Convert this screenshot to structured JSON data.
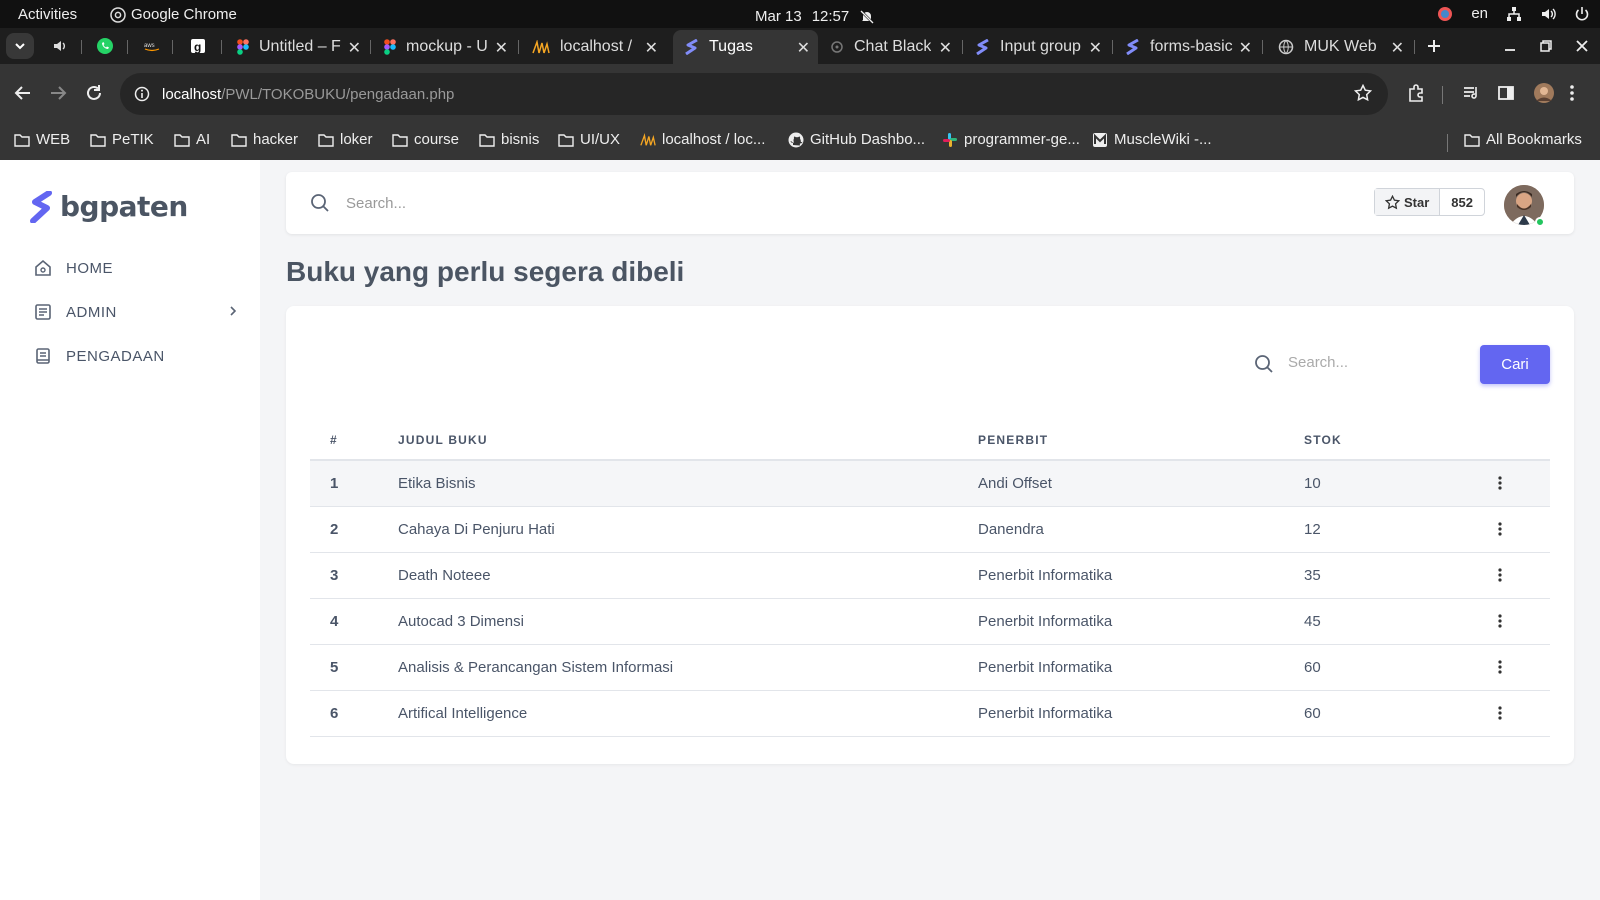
{
  "os_bar": {
    "activities": "Activities",
    "app_name": "Google Chrome",
    "date": "Mar 13",
    "time": "12:57",
    "language": "en"
  },
  "tabs": [
    {
      "title": "Untitled – F",
      "icon": "figma-icon"
    },
    {
      "title": "mockup - U",
      "icon": "figma-icon"
    },
    {
      "title": "localhost / ",
      "icon": "phpmyadmin-icon"
    },
    {
      "title": "Tugas",
      "icon": "bgpaten-icon",
      "active": true
    },
    {
      "title": "Chat Black",
      "icon": "blackbox-icon"
    },
    {
      "title": "Input group",
      "icon": "bgpaten-icon"
    },
    {
      "title": "forms-basic",
      "icon": "bgpaten-icon"
    },
    {
      "title": "MUK Web",
      "icon": "globe-icon"
    }
  ],
  "address_bar": {
    "host": "localhost",
    "path": "/PWL/TOKOBUKU/pengadaan.php"
  },
  "bookmarks": [
    {
      "label": "WEB",
      "icon": "folder-icon"
    },
    {
      "label": "PeTIK",
      "icon": "folder-icon"
    },
    {
      "label": "AI",
      "icon": "folder-icon"
    },
    {
      "label": "hacker",
      "icon": "folder-icon"
    },
    {
      "label": "loker",
      "icon": "folder-icon"
    },
    {
      "label": "course",
      "icon": "folder-icon"
    },
    {
      "label": "bisnis",
      "icon": "folder-icon"
    },
    {
      "label": "UI/UX",
      "icon": "folder-icon"
    },
    {
      "label": "localhost / loc...",
      "icon": "phpmyadmin-icon"
    },
    {
      "label": "GitHub Dashbo...",
      "icon": "github-icon"
    },
    {
      "label": "programmer-ge...",
      "icon": "slack-icon"
    },
    {
      "label": "MuscleWiki -...",
      "icon": "musclewiki-icon"
    }
  ],
  "all_bookmarks": "All Bookmarks",
  "sidebar": {
    "brand": "bgpaten",
    "brand_color": "#6366f1",
    "items": [
      {
        "label": "HOME",
        "icon": "home-icon"
      },
      {
        "label": "ADMIN",
        "icon": "list-icon",
        "has_submenu": true
      },
      {
        "label": "PENGADAAN",
        "icon": "book-icon"
      }
    ]
  },
  "topbar": {
    "search_placeholder": "Search...",
    "star_label": "Star",
    "star_count": "852"
  },
  "page": {
    "title": "Buku yang perlu segera dibeli",
    "search_placeholder": "Search...",
    "search_button": "Cari",
    "accent": "#6366f1"
  },
  "table": {
    "columns": [
      "#",
      "JUDUL BUKU",
      "PENERBIT",
      "STOK"
    ],
    "rows": [
      {
        "no": "1",
        "judul": "Etika Bisnis",
        "penerbit": "Andi Offset",
        "stok": "10"
      },
      {
        "no": "2",
        "judul": "Cahaya Di Penjuru Hati",
        "penerbit": "Danendra",
        "stok": "12"
      },
      {
        "no": "3",
        "judul": "Death Noteee",
        "penerbit": "Penerbit Informatika",
        "stok": "35"
      },
      {
        "no": "4",
        "judul": "Autocad 3 Dimensi",
        "penerbit": "Penerbit Informatika",
        "stok": "45"
      },
      {
        "no": "5",
        "judul": "Analisis & Perancangan Sistem Informasi",
        "penerbit": "Penerbit Informatika",
        "stok": "60"
      },
      {
        "no": "6",
        "judul": "Artifical Intelligence",
        "penerbit": "Penerbit Informatika",
        "stok": "60"
      }
    ]
  }
}
